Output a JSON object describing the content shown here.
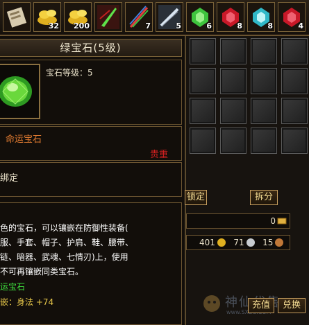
{
  "item_strip": [
    {
      "icon": "scroll-icon",
      "count": ""
    },
    {
      "icon": "gold-ingot-icon",
      "count": "32"
    },
    {
      "icon": "gold-ingot-icon",
      "count": "200"
    },
    {
      "icon": "green-slash-icon",
      "count": ""
    },
    {
      "icon": "rainbow-sword-icon",
      "count": "7"
    },
    {
      "icon": "silver-blade-icon",
      "count": "5"
    },
    {
      "icon": "green-gem-icon",
      "count": "6"
    },
    {
      "icon": "red-gem-icon",
      "count": "8"
    },
    {
      "icon": "cyan-gem-icon",
      "count": "8"
    },
    {
      "icon": "red-gem-icon",
      "count": "4"
    }
  ],
  "tooltip": {
    "title_name": "绿宝石",
    "title_level": "(5级)",
    "gem_level_label": "宝石等级：",
    "gem_level_value": "5",
    "category": "命运宝石",
    "rarity": "贵重",
    "binding": "绑定",
    "desc_lines": [
      "色的宝石，可以镶嵌在防御性装备(",
      "服、手套、帽子、护肩、鞋、腰带、",
      "链、暗器、武魂、七情刃)上，使用",
      "不可再镶嵌同类宝石。"
    ],
    "gem_type": "运宝石",
    "effect_label": "嵌：身法",
    "effect_value": "+74"
  },
  "panel": {
    "lock_label": "锁定",
    "split_label": "拆分",
    "gold_value": "0",
    "currency_1": "401",
    "currency_2": "71",
    "currency_3": "15",
    "recharge_label": "充值",
    "exchange_label": "兑换",
    "watermark": "神仙代售",
    "watermark_url": "www.SXDS.COM"
  },
  "colors": {
    "rarity_red": "#d22020",
    "gem_green": "#3ee03e",
    "effect_gold": "#e8c84a",
    "category_orange": "#e07a30"
  }
}
